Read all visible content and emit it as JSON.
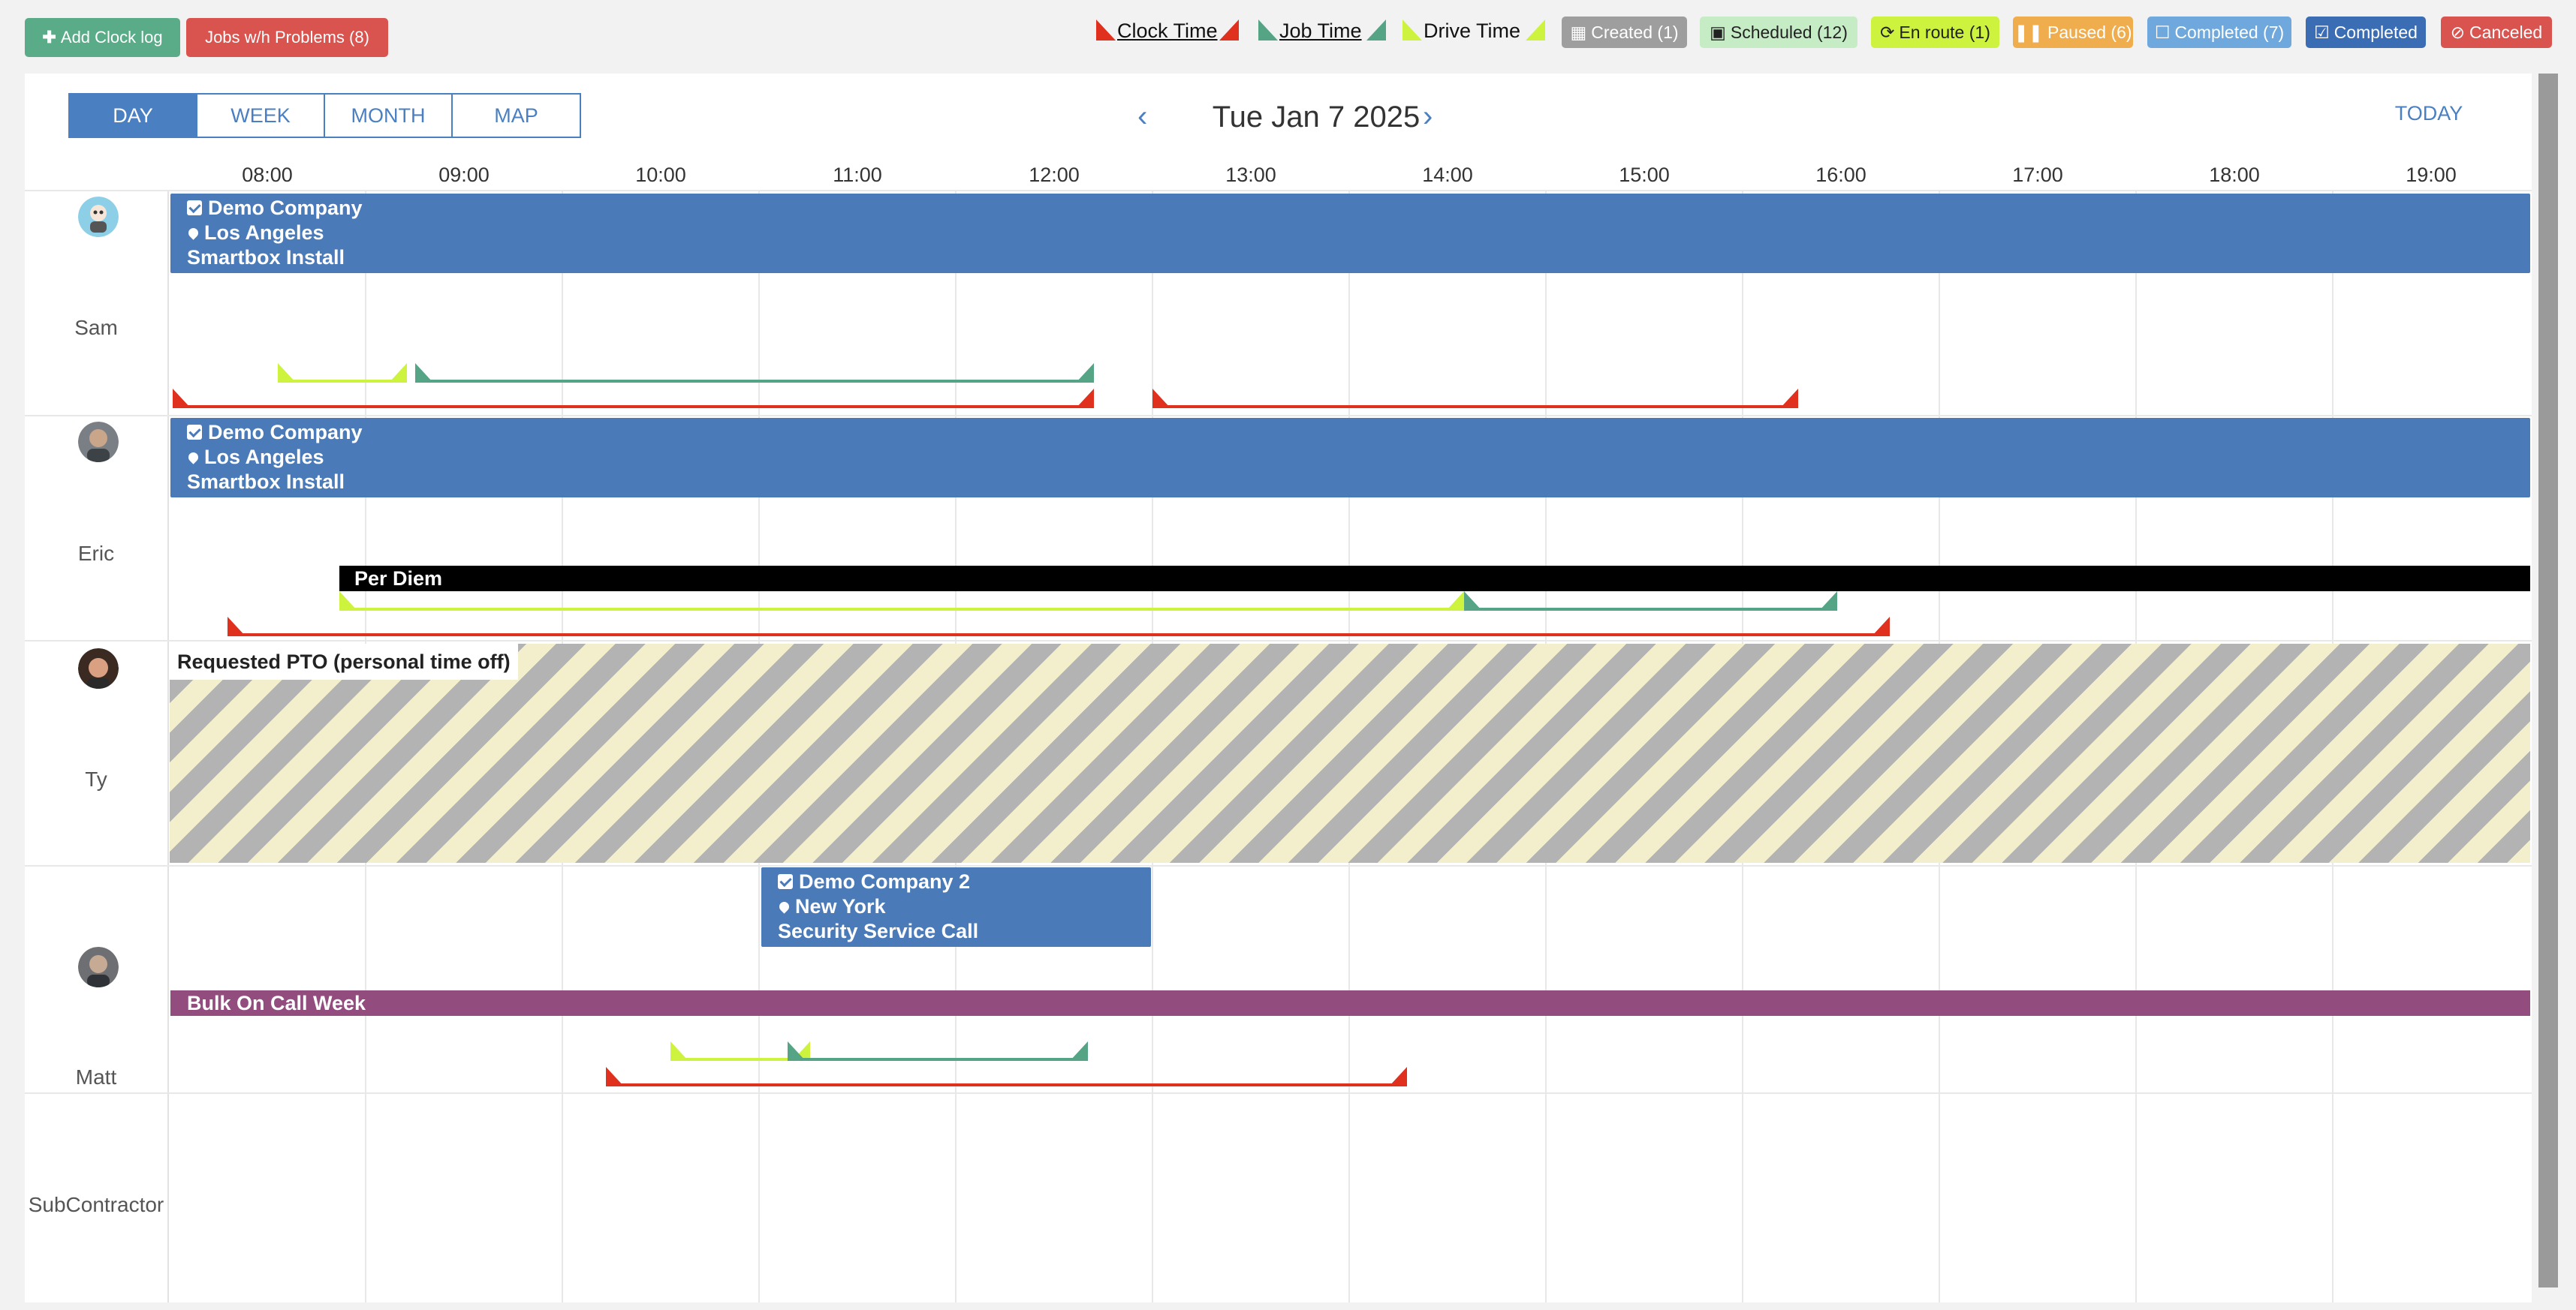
{
  "toolbar": {
    "add_clock_log": "Add Clock log",
    "jobs_problems": "Jobs w/h Problems (8)"
  },
  "legend": {
    "clock_time": "Clock Time",
    "job_time": "Job Time",
    "drive_time": "Drive Time"
  },
  "status_badges": {
    "created": "Created (1)",
    "scheduled": "Scheduled (12)",
    "en_route": "En route (1)",
    "paused": "Paused (6)",
    "completed_count": "Completed (7)",
    "completed": "Completed",
    "canceled": "Canceled"
  },
  "colors": {
    "clock_time": "#e0301e",
    "job_time": "#54a485",
    "drive_time": "#cdf33f",
    "event_blue": "#4a7ab8",
    "on_call": "#924c7e",
    "per_diem": "#000000"
  },
  "view_tabs": {
    "day": "DAY",
    "week": "WEEK",
    "month": "MONTH",
    "map": "MAP"
  },
  "calendar": {
    "date_title": "Tue Jan 7 2025",
    "today_label": "TODAY",
    "hours": [
      "08:00",
      "09:00",
      "10:00",
      "11:00",
      "12:00",
      "13:00",
      "14:00",
      "15:00",
      "16:00",
      "17:00",
      "18:00",
      "19:00"
    ]
  },
  "resources": [
    {
      "name": "Sam"
    },
    {
      "name": "Eric"
    },
    {
      "name": "Ty"
    },
    {
      "name": "Matt"
    },
    {
      "name": "SubContractor"
    }
  ],
  "events": {
    "sam_job": {
      "company": "Demo Company",
      "location": "Los Angeles",
      "service": "Smartbox Install"
    },
    "eric_job": {
      "company": "Demo Company",
      "location": "Los Angeles",
      "service": "Smartbox Install"
    },
    "eric_per_diem": "Per Diem",
    "ty_pto": "Requested PTO (personal time off)",
    "matt_job": {
      "company": "Demo Company 2",
      "location": "New York",
      "service": "Security Service Call"
    },
    "matt_on_call": "Bulk On Call Week"
  }
}
